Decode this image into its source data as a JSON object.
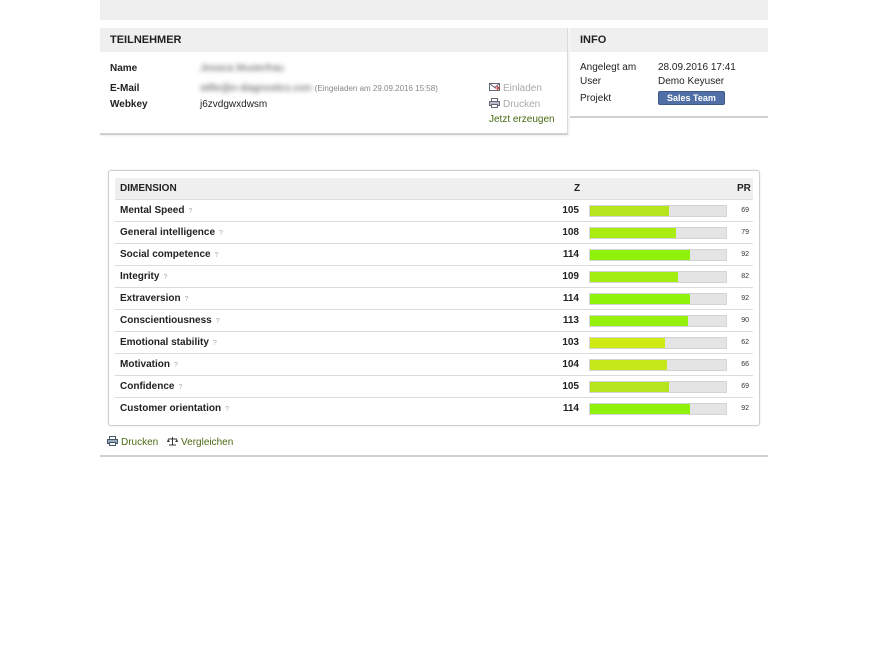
{
  "teilnehmer": {
    "title": "TEILNEHMER",
    "name_label": "Name",
    "name_value": "Jessica Musterfrau",
    "email_label": "E-Mail",
    "email_value": "stifte@e-diagnostics.com",
    "email_note": "(Eingeladen am 29.09.2016 15:58)",
    "webkey_label": "Webkey",
    "webkey_value": "j6zvdgwxdwsm",
    "action_invite": "Einladen",
    "action_print": "Drucken",
    "action_generate": "Jetzt erzeugen"
  },
  "info": {
    "title": "INFO",
    "created_label": "Angelegt am",
    "created_value": "28.09.2016 17:41",
    "user_label": "User",
    "user_value": "Demo Keyuser",
    "project_label": "Projekt",
    "project_value": "Sales Team"
  },
  "table": {
    "col_dimension": "DIMENSION",
    "col_z": "Z",
    "col_pr": "PR",
    "help_mark": "?",
    "z_scale": [
      70,
      130
    ],
    "rows": [
      {
        "dimension": "Mental Speed",
        "z": 105,
        "pr": 69,
        "color": "#b5e61d"
      },
      {
        "dimension": "General intelligence",
        "z": 108,
        "pr": 79,
        "color": "#a9ec12"
      },
      {
        "dimension": "Social competence",
        "z": 114,
        "pr": 92,
        "color": "#8ff20a"
      },
      {
        "dimension": "Integrity",
        "z": 109,
        "pr": 82,
        "color": "#a3ee10"
      },
      {
        "dimension": "Extraversion",
        "z": 114,
        "pr": 92,
        "color": "#8ff20a"
      },
      {
        "dimension": "Conscientiousness",
        "z": 113,
        "pr": 90,
        "color": "#93f10b"
      },
      {
        "dimension": "Emotional stability",
        "z": 103,
        "pr": 62,
        "color": "#cfea14"
      },
      {
        "dimension": "Motivation",
        "z": 104,
        "pr": 66,
        "color": "#c5e818"
      },
      {
        "dimension": "Confidence",
        "z": 105,
        "pr": 69,
        "color": "#b5e61d"
      },
      {
        "dimension": "Customer orientation",
        "z": 114,
        "pr": 92,
        "color": "#8ff20a"
      }
    ]
  },
  "footer": {
    "print_label": "Drucken",
    "compare_label": "Vergleichen"
  }
}
